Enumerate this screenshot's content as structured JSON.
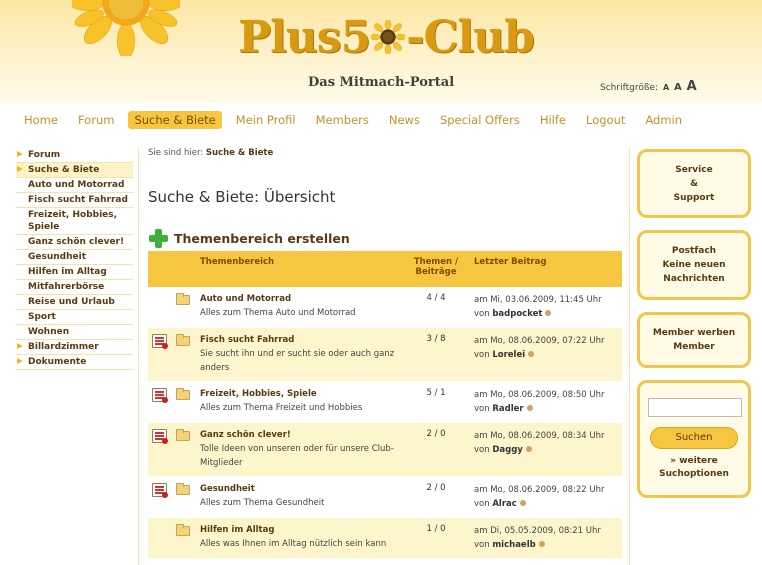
{
  "header": {
    "logo_text_left": "Plus5",
    "logo_text_right": "-Club",
    "tagline": "Das Mitmach-Portal",
    "fontsize_label": "Schriftgröße:",
    "fontsize_options": [
      "A",
      "A",
      "A"
    ]
  },
  "nav": {
    "items": [
      "Home",
      "Forum",
      "Suche & Biete",
      "Mein Profil",
      "Members",
      "News",
      "Special Offers",
      "Hilfe",
      "Logout",
      "Admin"
    ],
    "active": "Suche & Biete"
  },
  "sidebar": {
    "items": [
      {
        "label": "Forum",
        "arrow": true,
        "active": false
      },
      {
        "label": "Suche & Biete",
        "arrow": true,
        "active": true
      },
      {
        "label": "Auto und Motorrad",
        "arrow": false,
        "active": false
      },
      {
        "label": "Fisch sucht Fahrrad",
        "arrow": false,
        "active": false
      },
      {
        "label": "Freizeit, Hobbies, Spiele",
        "arrow": false,
        "active": false
      },
      {
        "label": "Ganz schön clever!",
        "arrow": false,
        "active": false
      },
      {
        "label": "Gesundheit",
        "arrow": false,
        "active": false
      },
      {
        "label": "Hilfen im Alltag",
        "arrow": false,
        "active": false
      },
      {
        "label": "Mitfahrerbörse",
        "arrow": false,
        "active": false
      },
      {
        "label": "Reise und Urlaub",
        "arrow": false,
        "active": false
      },
      {
        "label": "Sport",
        "arrow": false,
        "active": false
      },
      {
        "label": "Wohnen",
        "arrow": false,
        "active": false
      },
      {
        "label": "Billardzimmer",
        "arrow": true,
        "active": false
      },
      {
        "label": "Dokumente",
        "arrow": true,
        "active": false
      }
    ]
  },
  "main": {
    "breadcrumb_prefix": "Sie sind hier:",
    "breadcrumb_current": "Suche & Biete",
    "page_title": "Suche & Biete: Übersicht",
    "create_label": "Themenbereich erstellen",
    "table": {
      "headers": {
        "topic": "Themenbereich",
        "counts_line1": "Themen /",
        "counts_line2": "Beiträge",
        "last": "Letzter Beitrag"
      },
      "rows": [
        {
          "new": false,
          "title": "Auto und Motorrad",
          "desc": "Alles zum Thema Auto und Motorrad",
          "counts": "4 / 4",
          "last_date": "am Mi, 03.06.2009, 11:45 Uhr",
          "last_by": "von",
          "last_user": "badpocket"
        },
        {
          "new": true,
          "title": "Fisch sucht Fahrrad",
          "desc": "Sie sucht ihn und er sucht sie oder auch ganz anders",
          "counts": "3 / 8",
          "last_date": "am Mo, 08.06.2009, 07:22 Uhr",
          "last_by": "von",
          "last_user": "Lorelei"
        },
        {
          "new": true,
          "title": "Freizeit, Hobbies, Spiele",
          "desc": "Alles zum Thema Freizeit und Hobbies",
          "counts": "5 / 1",
          "last_date": "am Mo, 08.06.2009, 08:50 Uhr",
          "last_by": "von",
          "last_user": "Radler"
        },
        {
          "new": true,
          "title": "Ganz schön clever!",
          "desc": "Tolle Ideen von unseren oder für unsere Club-Mitglieder",
          "counts": "2 / 0",
          "last_date": "am Mo, 08.06.2009, 08:34 Uhr",
          "last_by": "von",
          "last_user": "Daggy"
        },
        {
          "new": true,
          "title": "Gesundheit",
          "desc": "Alles zum Thema Gesundheit",
          "counts": "2 / 0",
          "last_date": "am Mo, 08.06.2009, 08:22 Uhr",
          "last_by": "von",
          "last_user": "Alrac"
        },
        {
          "new": false,
          "title": "Hilfen im Alltag",
          "desc": "Alles was Ihnen im Alltag nützlich sein kann",
          "counts": "1 / 0",
          "last_date": "am Di, 05.05.2009, 08:21 Uhr",
          "last_by": "von",
          "last_user": "michaelb"
        }
      ]
    }
  },
  "right": {
    "service_lines": [
      "Service",
      "&",
      "Support"
    ],
    "postfach_lines": [
      "Postfach",
      "Keine neuen",
      "Nachrichten"
    ],
    "member_lines": [
      "Member werben",
      "Member"
    ],
    "search_placeholder": "",
    "search_button": "Suchen",
    "more_lines": [
      "» weitere",
      "Suchoptionen"
    ]
  },
  "colors": {
    "accent": "#f7c640",
    "nav_text": "#c8902a",
    "brown": "#5a3a10",
    "row_alt": "#fdf5cc"
  }
}
